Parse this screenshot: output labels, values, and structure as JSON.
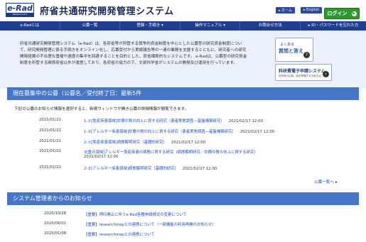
{
  "header": {
    "logo_text": "e-Rad",
    "logo_sub": "Research and Development",
    "site_title": "府省共通研究開発管理システム",
    "home_link": "▸ ホーム",
    "english_link": "▸ English",
    "login_label": "ログイン"
  },
  "nav": {
    "items": [
      "e-Radとは",
      "公募一覧",
      "登録・手続き ▾",
      "操作マニュアル ▾",
      "お問合せ方法",
      "▸ ID・パスワードを忘れた方"
    ]
  },
  "intro": {
    "text": "府省共通研究開発管理システム（e-Rad）は、各府省等が所管する競争的資金制度を中心とした公募型の研究資金制度について、研究開発管理に係る手続きをオンライン化し、応募受付から実績報告等の一連の業務を支援するとともに、研究者への研究開発経費の不合理な重複や過度の集中を回避することを目的とした、府省横断的なシステムです。 e-Radは、公募型の研究資金制度を所管する関係府省以外が運営しており、各府省の協力の下、文部科学省がシステムの開発及び運用を行っています。",
    "faq_title1": "よくある",
    "faq_title2": "質問と答え",
    "manual_title": "科研費電子申請システム",
    "manual_sub": "科研費の応募、採択等関する手続きはこちら"
  },
  "current_section": {
    "title": "現在募集中の公募（公募名／受付終了日：最新5件",
    "notice": "下記の公募のお知らせ情報を選択すると、新規ウィンドウが開き公募の詳細情報が閲覧できます。",
    "items": [
      {
        "date": "2021/01/21",
        "title": "1-①[免疫疾患領域]診療の質の向上に資する研究（患者実態調査—基盤構築研究）",
        "deadline": "2021/02/17 12:00"
      },
      {
        "date": "2021/01/21",
        "title": "1-②[アレルギー疾患領域]診療の質の向上に資する研究（患者実態調査—基盤構築研究）",
        "deadline": "2021/02/17 12:00"
      },
      {
        "date": "2021/01/21",
        "title": "2-①[免疫疾患領域]病態解明研究（基礎的研究）",
        "deadline": "2021/02/17 12:00"
      },
      {
        "date": "2021/01/21",
        "title": "3[重点領域]アレルギー免疫疾患の病態に資する研究（病態解明研究／診療の質の向上に資する研究）",
        "deadline": "2021/02/17 12:00"
      },
      {
        "date": "2021/01/21",
        "title": "2-②[アレルギー疾患領域]病態解明研究（基礎的研究）",
        "deadline": "2021/02/17 12:00"
      }
    ],
    "more_label": "公募一覧へ",
    "more_arrow": "▸"
  },
  "news_section": {
    "title": "システム管理者からのお知らせ",
    "items": [
      {
        "date": "2020/10/28",
        "title": "【重要】押印廃止に伴うe-Rad各種申請様式の変更について"
      },
      {
        "date": "2020/06/02",
        "title": "【重要】researchmapとの連携について（一部機能の利用再開のお知らせ）"
      },
      {
        "date": "2020/01/08",
        "title": "【重要】researchmapとの連携について"
      }
    ]
  },
  "colors": {
    "nav_bg": "#1d3f8f",
    "section_bg": "#4576c8",
    "login_bg": "#2d9a2d",
    "link": "#1d4fc0",
    "intro_bg": "#eaf1fb"
  }
}
